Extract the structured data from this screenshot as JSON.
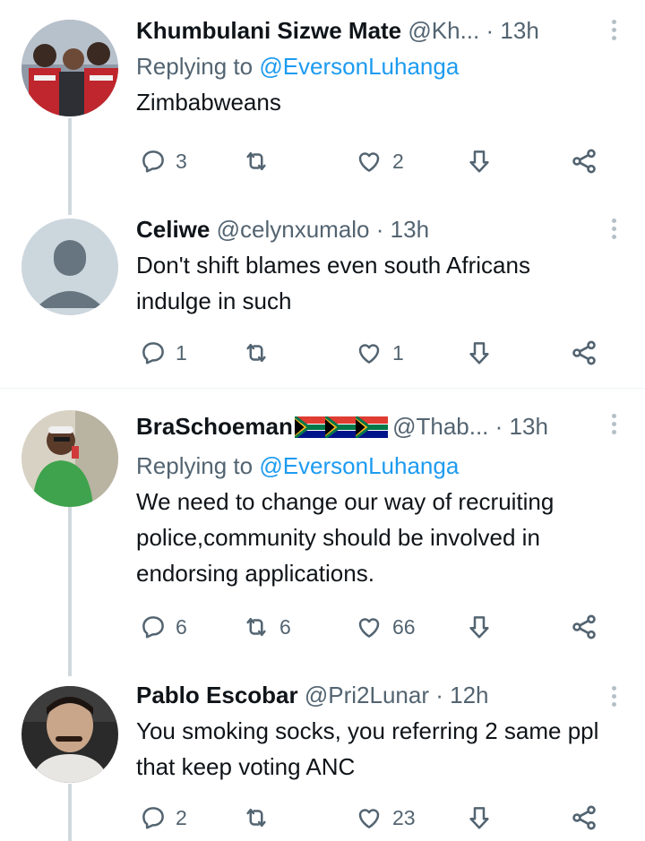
{
  "tweets": [
    {
      "name": "Khumbulani Sizwe Mate",
      "handle": "@Kh...",
      "dot": "·",
      "time": "13h",
      "replying_prefix": "Replying to ",
      "replying_to": "@EversonLuhanga",
      "text": "Zimbabweans",
      "reply_count": "3",
      "retweet_count": "",
      "like_count": "2"
    },
    {
      "name": "Celiwe",
      "handle": "@celynxumalo",
      "dot": "·",
      "time": "13h",
      "text": "Don't shift blames even south Africans indulge in such",
      "reply_count": "1",
      "retweet_count": "",
      "like_count": "1"
    },
    {
      "name": "BraSchoeman",
      "flag_icons": "south-africa-flag-icon x3",
      "handle": "@Thab...",
      "dot": "·",
      "time": "13h",
      "replying_prefix": "Replying to ",
      "replying_to": "@EversonLuhanga",
      "text": "We need to change our way of recruiting police,community should be involved in endorsing applications.",
      "reply_count": "6",
      "retweet_count": "6",
      "like_count": "66"
    },
    {
      "name": "Pablo Escobar",
      "handle": "@Pri2Lunar",
      "dot": "·",
      "time": "12h",
      "text": "You smoking socks, you referring 2 same ppl that keep voting ANC",
      "reply_count": "2",
      "retweet_count": "",
      "like_count": "23"
    }
  ],
  "icons": {
    "reply": "reply-icon",
    "retweet": "retweet-icon",
    "like": "heart-icon",
    "bookmark": "bookmark-download-icon",
    "share": "share-icon",
    "more": "more-vertical-icon"
  },
  "colors": {
    "text": "#0f1419",
    "secondary": "#536471",
    "link": "#1d9bf0",
    "thread_line": "#cfd9de",
    "divider": "#eff3f4"
  }
}
